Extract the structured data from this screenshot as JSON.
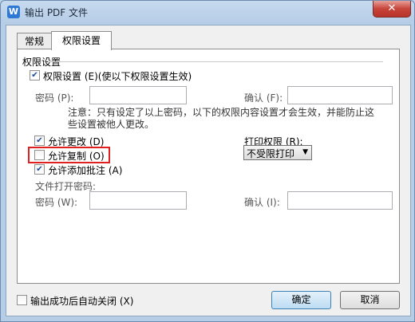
{
  "window": {
    "title": "输出 PDF 文件",
    "close": "✕"
  },
  "tabs": [
    {
      "label": "常规"
    },
    {
      "label": "权限设置"
    }
  ],
  "permissions": {
    "group_title": "权限设置",
    "enable_checkbox": {
      "label": "权限设置 (E)(使以下权限设置生效)",
      "checked": true
    },
    "password": {
      "label": "密码 (P):",
      "value": ""
    },
    "confirm": {
      "label": "确认 (F):",
      "value": ""
    },
    "note": "注意：只有设定了以上密码，以下的权限内容设置才会生效，并能防止这些设置被他人更改。",
    "allow_edit": {
      "label": "允许更改 (D)",
      "checked": true
    },
    "allow_copy": {
      "label": "允许复制 (O)",
      "checked": false
    },
    "allow_annotate": {
      "label": "允许添加批注 (A)",
      "checked": true
    },
    "print_label": "打印权限 (R):",
    "print_select": "不受限打印",
    "open_password_title": "文件打开密码:",
    "open_password": {
      "label": "密码 (W):",
      "value": ""
    },
    "open_confirm": {
      "label": "确认 (I):",
      "value": ""
    }
  },
  "footer": {
    "auto_close": {
      "label": "输出成功后自动关闭 (X)",
      "checked": false
    },
    "ok": "确定",
    "cancel": "取消"
  },
  "colors": {
    "highlight": "#e02020",
    "accent": "#3c7fb1"
  },
  "icons": {
    "app": "wps-w-icon",
    "check": "checkmark-icon",
    "dropdown": "triangle-down-icon"
  }
}
